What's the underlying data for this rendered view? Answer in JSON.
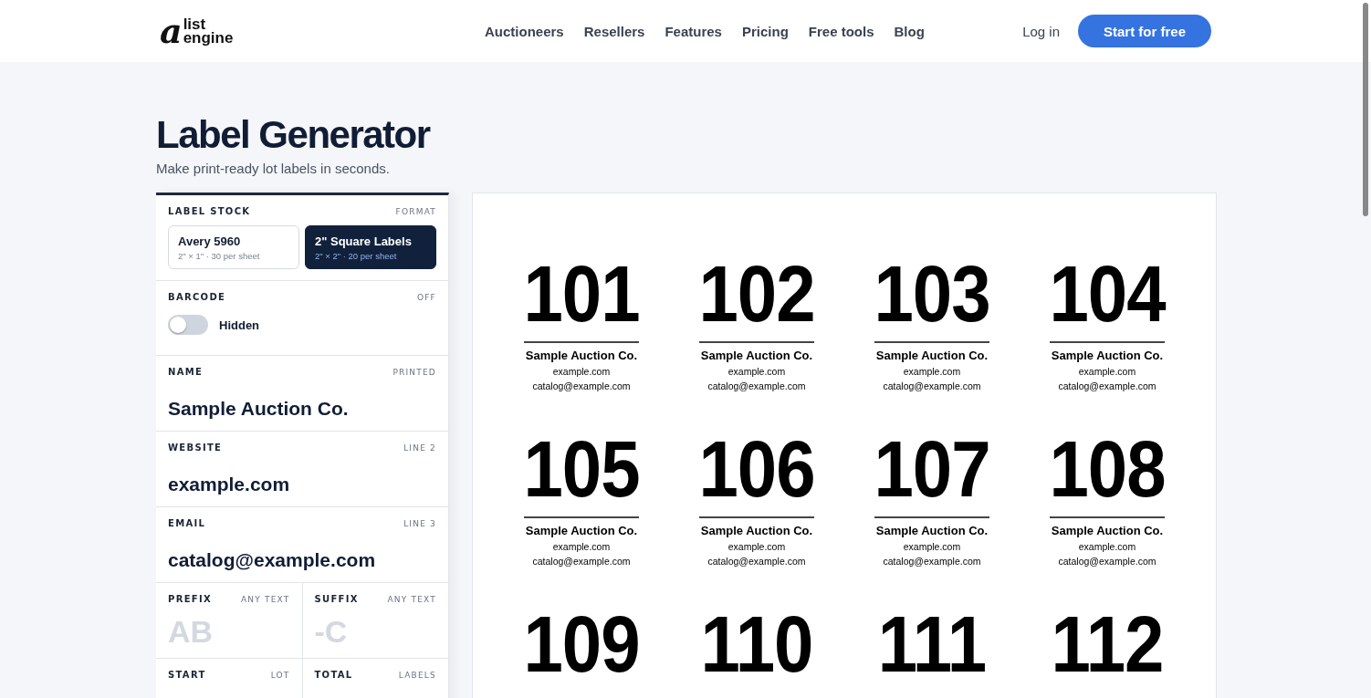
{
  "logo": {
    "mark": "a",
    "line1": "list",
    "line2": "engine"
  },
  "nav": {
    "links": [
      "Auctioneers",
      "Resellers",
      "Features",
      "Pricing",
      "Free tools",
      "Blog"
    ],
    "login": "Log in",
    "cta": "Start for free"
  },
  "page": {
    "title": "Label Generator",
    "subtitle": "Make print-ready lot labels in seconds."
  },
  "panel": {
    "stock": {
      "label": "LABEL STOCK",
      "hint": "FORMAT",
      "options": [
        {
          "name": "Avery 5960",
          "detail": "2\" × 1\" · 30 per sheet",
          "selected": false
        },
        {
          "name": "2\" Square Labels",
          "detail": "2\" × 2\" · 20 per sheet",
          "selected": true
        }
      ]
    },
    "barcode": {
      "label": "BARCODE",
      "hint": "OFF",
      "on": false,
      "text": "Hidden"
    },
    "fields": [
      {
        "label": "NAME",
        "hint": "PRINTED",
        "value": "Sample Auction Co."
      },
      {
        "label": "WEBSITE",
        "hint": "LINE 2",
        "value": "example.com"
      },
      {
        "label": "EMAIL",
        "hint": "LINE 3",
        "value": "catalog@example.com"
      }
    ],
    "pairs": [
      [
        {
          "label": "PREFIX",
          "hint": "ANY TEXT",
          "placeholder": "AB"
        },
        {
          "label": "SUFFIX",
          "hint": "ANY TEXT",
          "placeholder": "-C"
        }
      ],
      [
        {
          "label": "START",
          "hint": "LOT"
        },
        {
          "label": "TOTAL",
          "hint": "LABELS"
        }
      ]
    ]
  },
  "preview": {
    "labels": [
      {
        "number": "101",
        "name": "Sample Auction Co.",
        "website": "example.com",
        "email": "catalog@example.com"
      },
      {
        "number": "102",
        "name": "Sample Auction Co.",
        "website": "example.com",
        "email": "catalog@example.com"
      },
      {
        "number": "103",
        "name": "Sample Auction Co.",
        "website": "example.com",
        "email": "catalog@example.com"
      },
      {
        "number": "104",
        "name": "Sample Auction Co.",
        "website": "example.com",
        "email": "catalog@example.com"
      },
      {
        "number": "105",
        "name": "Sample Auction Co.",
        "website": "example.com",
        "email": "catalog@example.com"
      },
      {
        "number": "106",
        "name": "Sample Auction Co.",
        "website": "example.com",
        "email": "catalog@example.com"
      },
      {
        "number": "107",
        "name": "Sample Auction Co.",
        "website": "example.com",
        "email": "catalog@example.com"
      },
      {
        "number": "108",
        "name": "Sample Auction Co.",
        "website": "example.com",
        "email": "catalog@example.com"
      },
      {
        "number": "109"
      },
      {
        "number": "110"
      },
      {
        "number": "111"
      },
      {
        "number": "112"
      }
    ]
  }
}
